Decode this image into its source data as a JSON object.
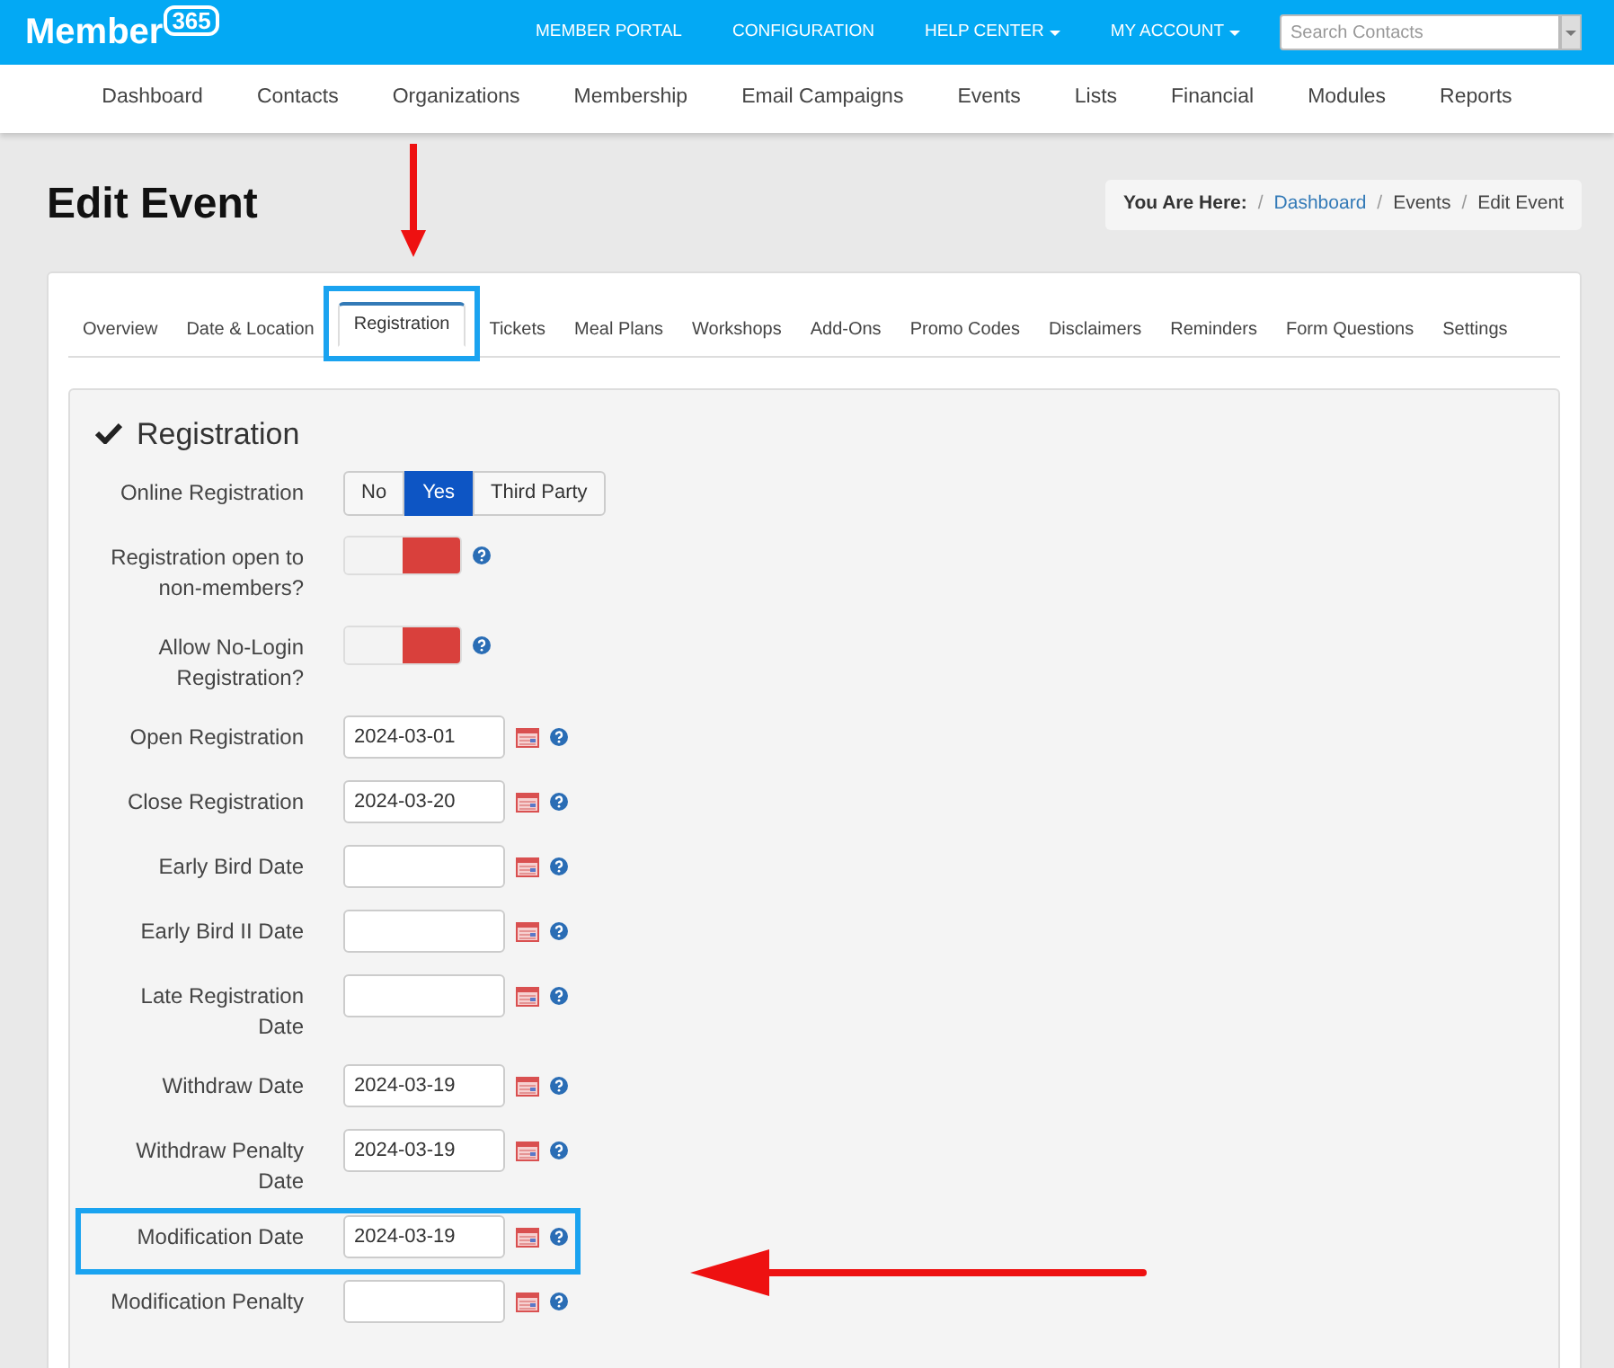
{
  "header": {
    "logo": "Member",
    "logo_badge": "365",
    "links": [
      {
        "label": "MEMBER PORTAL",
        "dropdown": false
      },
      {
        "label": "CONFIGURATION",
        "dropdown": false
      },
      {
        "label": "HELP CENTER",
        "dropdown": true
      },
      {
        "label": "MY ACCOUNT",
        "dropdown": true
      }
    ],
    "search": {
      "placeholder": "Search Contacts"
    }
  },
  "nav": [
    "Dashboard",
    "Contacts",
    "Organizations",
    "Membership",
    "Email Campaigns",
    "Events",
    "Lists",
    "Financial",
    "Modules",
    "Reports"
  ],
  "page_title": "Edit Event",
  "breadcrumb": {
    "label": "You Are Here:",
    "separator": "/",
    "items": [
      {
        "text": "Dashboard",
        "link": true
      },
      {
        "text": "Events",
        "link": false
      },
      {
        "text": "Edit Event",
        "link": false
      }
    ]
  },
  "tabs": [
    {
      "label": "Overview",
      "selected": false,
      "highlighted": false
    },
    {
      "label": "Date & Location",
      "selected": false,
      "highlighted": false
    },
    {
      "label": "Registration",
      "selected": true,
      "highlighted": true
    },
    {
      "label": "Tickets",
      "selected": false,
      "highlighted": false
    },
    {
      "label": "Meal Plans",
      "selected": false,
      "highlighted": false
    },
    {
      "label": "Workshops",
      "selected": false,
      "highlighted": false
    },
    {
      "label": "Add-Ons",
      "selected": false,
      "highlighted": false
    },
    {
      "label": "Promo Codes",
      "selected": false,
      "highlighted": false
    },
    {
      "label": "Disclaimers",
      "selected": false,
      "highlighted": false
    },
    {
      "label": "Reminders",
      "selected": false,
      "highlighted": false
    },
    {
      "label": "Form Questions",
      "selected": false,
      "highlighted": false
    },
    {
      "label": "Settings",
      "selected": false,
      "highlighted": false
    }
  ],
  "section": {
    "title": "Registration",
    "fields": [
      {
        "kind": "segmented",
        "label": "Online Registration",
        "highlighted": false,
        "options": [
          {
            "label": "No",
            "selected": false
          },
          {
            "label": "Yes",
            "selected": true
          },
          {
            "label": "Third Party",
            "selected": false
          }
        ]
      },
      {
        "kind": "toggle",
        "label": "Registration open to non-members?",
        "highlighted": false,
        "on": false
      },
      {
        "kind": "toggle",
        "label": "Allow No-Login Registration?",
        "highlighted": false,
        "on": false
      },
      {
        "kind": "date",
        "label": "Open Registration",
        "highlighted": false,
        "value": "2024-03-01"
      },
      {
        "kind": "date",
        "label": "Close Registration",
        "highlighted": false,
        "value": "2024-03-20"
      },
      {
        "kind": "date",
        "label": "Early Bird Date",
        "highlighted": false
      },
      {
        "kind": "date",
        "label": "Early Bird II Date",
        "highlighted": false
      },
      {
        "kind": "date",
        "label": "Late Registration Date",
        "highlighted": false
      },
      {
        "kind": "date",
        "label": "Withdraw Date",
        "highlighted": false,
        "value": "2024-03-19"
      },
      {
        "kind": "date",
        "label": "Withdraw Penalty Date",
        "highlighted": false,
        "value": "2024-03-19"
      },
      {
        "kind": "date",
        "label": "Modification Date",
        "highlighted": true,
        "value": "2024-03-19"
      },
      {
        "kind": "date",
        "label": "Modification Penalty",
        "highlighted": false
      }
    ]
  }
}
